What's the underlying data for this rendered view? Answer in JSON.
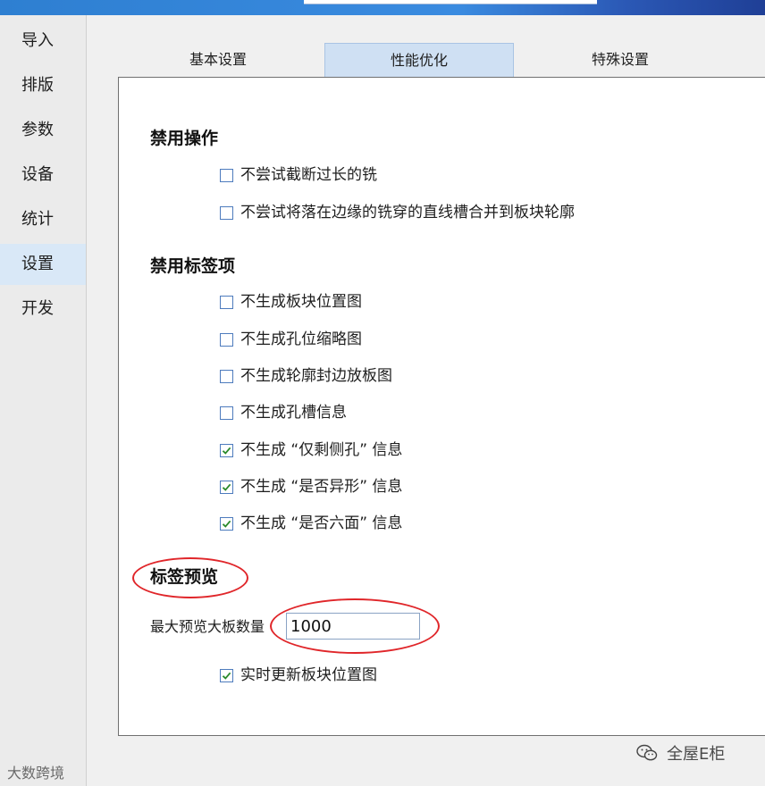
{
  "sidebar": {
    "items": [
      {
        "label": "导入",
        "active": false
      },
      {
        "label": "排版",
        "active": false
      },
      {
        "label": "参数",
        "active": false
      },
      {
        "label": "设备",
        "active": false
      },
      {
        "label": "统计",
        "active": false
      },
      {
        "label": "设置",
        "active": true
      },
      {
        "label": "开发",
        "active": false
      }
    ]
  },
  "tabs": [
    {
      "label": "基本设置",
      "active": false
    },
    {
      "label": "性能优化",
      "active": true
    },
    {
      "label": "特殊设置",
      "active": false
    }
  ],
  "sections": {
    "disable_ops": {
      "title": "禁用操作",
      "options": [
        {
          "label": "不尝试截断过长的铣",
          "checked": false
        },
        {
          "label": "不尝试将落在边缘的铣穿的直线槽合并到板块轮廓",
          "checked": false
        }
      ]
    },
    "disable_labels": {
      "title": "禁用标签项",
      "options": [
        {
          "label": "不生成板块位置图",
          "checked": false
        },
        {
          "label": "不生成孔位缩略图",
          "checked": false
        },
        {
          "label": "不生成轮廓封边放板图",
          "checked": false
        },
        {
          "label": "不生成孔槽信息",
          "checked": false
        },
        {
          "label": "不生成 “仅剩侧孔” 信息",
          "checked": true
        },
        {
          "label": "不生成 “是否异形” 信息",
          "checked": true
        },
        {
          "label": "不生成 “是否六面” 信息",
          "checked": true
        }
      ]
    },
    "label_preview": {
      "title": "标签预览",
      "max_boards_label": "最大预览大板数量",
      "max_boards_value": "1000",
      "realtime_option": {
        "label": "实时更新板块位置图",
        "checked": true
      }
    }
  },
  "watermarks": {
    "left": "大数跨境",
    "right": "全屋E柜"
  },
  "colors": {
    "accent": "#cfe0f3",
    "checkmark": "#2a8a2a",
    "annotation_ring": "#e0262a",
    "topbar": "#3a8be0"
  }
}
